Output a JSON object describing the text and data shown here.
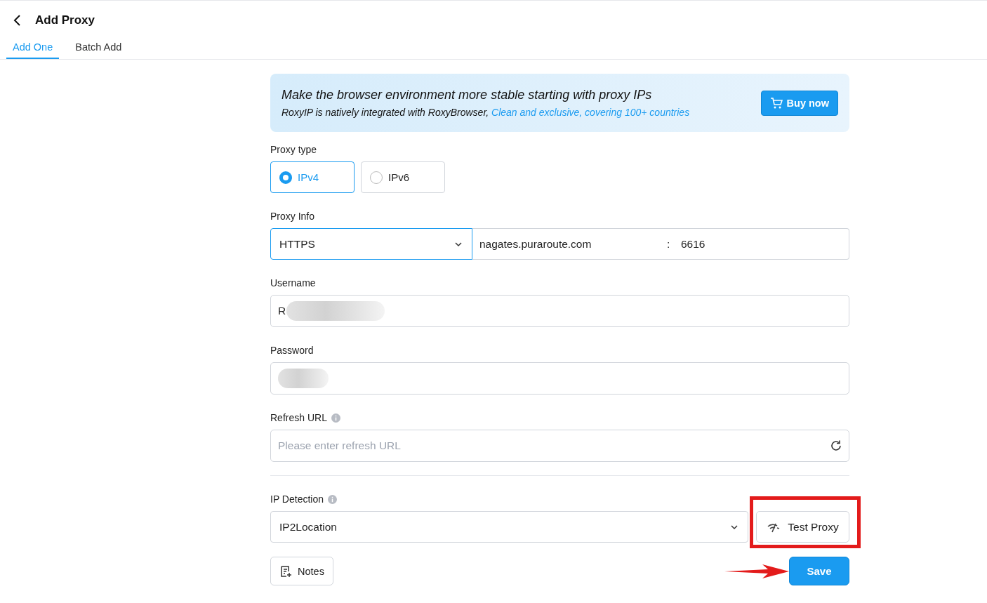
{
  "header": {
    "title": "Add Proxy"
  },
  "tabs": [
    {
      "label": "Add One",
      "selected": true
    },
    {
      "label": "Batch Add",
      "selected": false
    }
  ],
  "banner": {
    "headline": "Make the browser environment more stable starting with proxy IPs",
    "text": "RoxyIP is natively integrated with RoxyBrowser, ",
    "highlight": "Clean and exclusive, covering 100+ countries",
    "button": "Buy now"
  },
  "proxy_type": {
    "label": "Proxy type",
    "options": [
      {
        "label": "IPv4",
        "selected": true
      },
      {
        "label": "IPv6",
        "selected": false
      }
    ]
  },
  "proxy_info": {
    "label": "Proxy Info",
    "protocol": "HTTPS",
    "host": "nagates.puraroute.com",
    "separator": ":",
    "port": "6616"
  },
  "username": {
    "label": "Username",
    "value": "R",
    "redacted": true
  },
  "password": {
    "label": "Password",
    "redacted": true
  },
  "refresh_url": {
    "label": "Refresh URL",
    "placeholder": "Please enter refresh URL"
  },
  "ip_detection": {
    "label": "IP Detection",
    "value": "IP2Location",
    "test_button": "Test Proxy"
  },
  "footer": {
    "notes_button": "Notes",
    "save_button": "Save"
  },
  "annotations": {
    "highlight_test_proxy": true,
    "arrow_to_save": true
  }
}
